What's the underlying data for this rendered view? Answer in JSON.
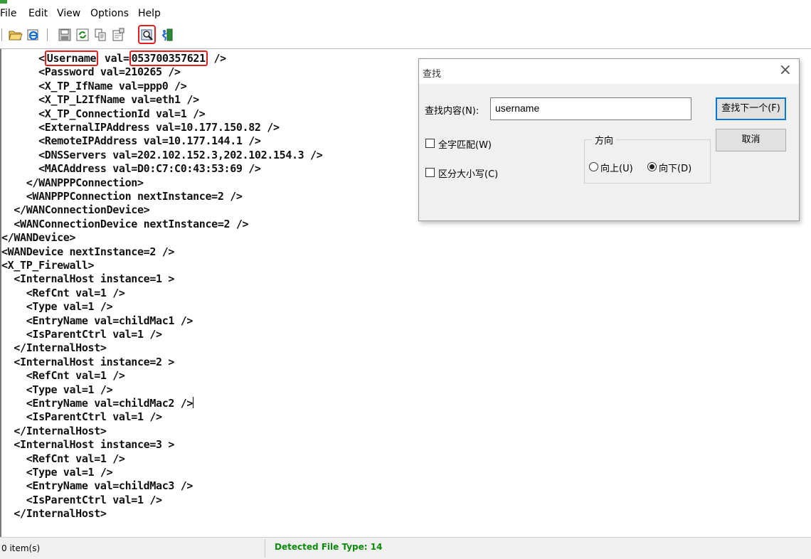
{
  "menu": {
    "items": [
      "File",
      "Edit",
      "View",
      "Options",
      "Help"
    ]
  },
  "toolbar": {
    "icons": [
      "open-folder-icon",
      "open-ie-icon",
      "save-icon",
      "refresh-icon",
      "copy-icon",
      "properties-icon",
      "find-icon",
      "exit-icon"
    ],
    "highlighted": "find-icon"
  },
  "editor": {
    "lines": [
      {
        "prefix": "      <",
        "hl1": "Username",
        "mid": " val=",
        "hl2": "053700357621",
        "suffix": " />"
      },
      {
        "text": "      <Password val=210265 />"
      },
      {
        "text": "      <X_TP_IfName val=ppp0 />"
      },
      {
        "text": "      <X_TP_L2IfName val=eth1 />"
      },
      {
        "text": "      <X_TP_ConnectionId val=1 />"
      },
      {
        "text": "      <ExternalIPAddress val=10.177.150.82 />"
      },
      {
        "text": "      <RemoteIPAddress val=10.177.144.1 />"
      },
      {
        "text": "      <DNSServers val=202.102.152.3,202.102.154.3 />"
      },
      {
        "text": "      <MACAddress val=D0:C7:C0:43:53:69 />"
      },
      {
        "text": "    </WANPPPConnection>"
      },
      {
        "text": "    <WANPPPConnection nextInstance=2 />"
      },
      {
        "text": "  </WANConnectionDevice>"
      },
      {
        "text": "  <WANConnectionDevice nextInstance=2 />"
      },
      {
        "text": "</WANDevice>"
      },
      {
        "text": "<WANDevice nextInstance=2 />"
      },
      {
        "text": "<X_TP_Firewall>"
      },
      {
        "text": "  <InternalHost instance=1 >"
      },
      {
        "text": "    <RefCnt val=1 />"
      },
      {
        "text": "    <Type val=1 />"
      },
      {
        "text": "    <EntryName val=childMac1 />"
      },
      {
        "text": "    <IsParentCtrl val=1 />"
      },
      {
        "text": "  </InternalHost>"
      },
      {
        "text": "  <InternalHost instance=2 >"
      },
      {
        "text": "    <RefCnt val=1 />"
      },
      {
        "text": "    <Type val=1 />"
      },
      {
        "text": "    <EntryName val=childMac2 />",
        "caret": true
      },
      {
        "text": "    <IsParentCtrl val=1 />"
      },
      {
        "text": "  </InternalHost>"
      },
      {
        "text": "  <InternalHost instance=3 >"
      },
      {
        "text": "    <RefCnt val=1 />"
      },
      {
        "text": "    <Type val=1 />"
      },
      {
        "text": "    <EntryName val=childMac3 />"
      },
      {
        "text": "    <IsParentCtrl val=1 />"
      },
      {
        "text": "  </InternalHost>"
      }
    ]
  },
  "find_dialog": {
    "title": "查找",
    "close": "×",
    "find_label": "查找内容(N):",
    "find_value": "username",
    "find_next_label": "查找下一个(F)",
    "cancel_label": "取消",
    "whole_word_label": "全字匹配(W)",
    "whole_word_checked": false,
    "match_case_label": "区分大小写(C)",
    "match_case_checked": false,
    "direction_label": "方向",
    "up_label": "向上(U)",
    "down_label": "向下(D)",
    "direction_selected": "down"
  },
  "status": {
    "items_text": "0 item(s)",
    "file_type_text": "Detected File Type: 14",
    "file_type_color": "#0a8a0a"
  },
  "colors": {
    "highlight": "#e02020",
    "dialog_focus": "#0078d7"
  }
}
